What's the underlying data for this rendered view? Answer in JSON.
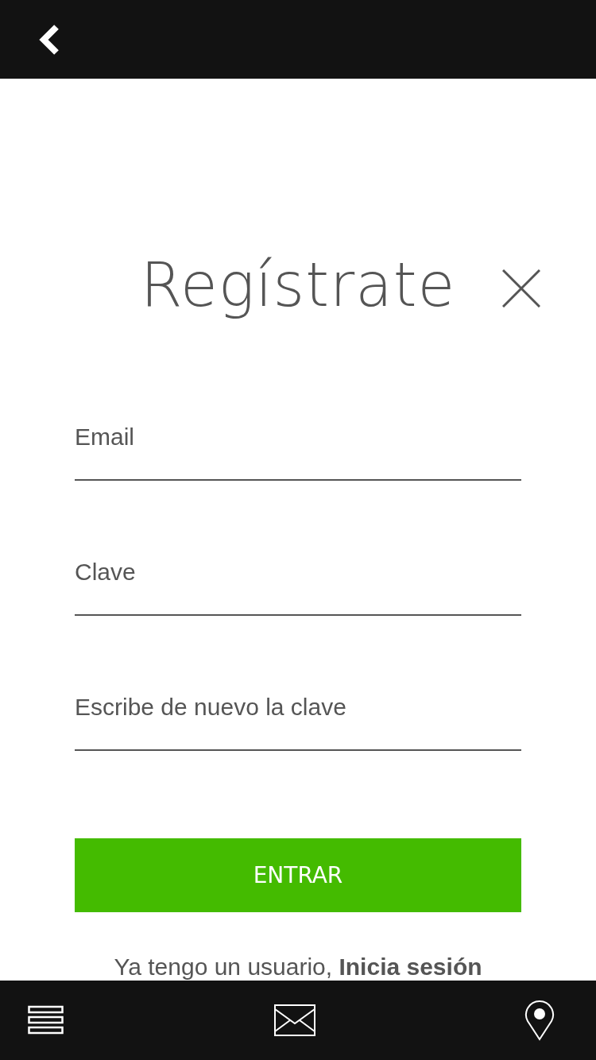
{
  "title": "Regístrate",
  "fields": [
    {
      "placeholder": "Email"
    },
    {
      "placeholder": "Clave"
    },
    {
      "placeholder": "Escribe de nuevo la clave"
    }
  ],
  "submit": "ENTRAR",
  "signin": {
    "prompt": "Ya tengo un usuario,",
    "link": "Inicia sesión"
  }
}
